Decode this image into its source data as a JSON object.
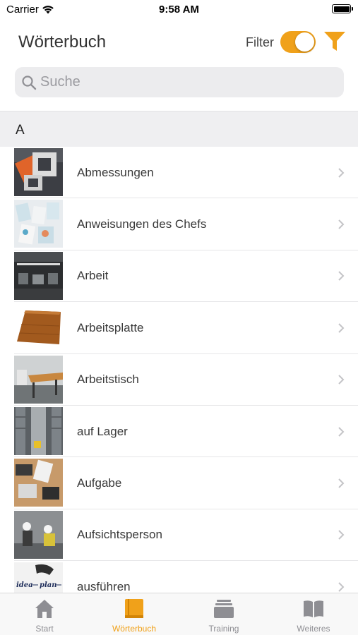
{
  "status_bar": {
    "carrier": "Carrier",
    "time": "9:58 AM"
  },
  "header": {
    "title": "Wörterbuch",
    "filter_label": "Filter",
    "filter_on": true
  },
  "search": {
    "placeholder": "Suche"
  },
  "section": {
    "letter": "A"
  },
  "entries": [
    {
      "label": "Abmessungen"
    },
    {
      "label": "Anweisungen des Chefs"
    },
    {
      "label": "Arbeit"
    },
    {
      "label": "Arbeitsplatte"
    },
    {
      "label": "Arbeitstisch"
    },
    {
      "label": "auf Lager"
    },
    {
      "label": "Aufgabe"
    },
    {
      "label": "Aufsichtsperson"
    },
    {
      "label": "ausführen",
      "thumb_text": [
        "idea",
        "plan"
      ]
    }
  ],
  "tabs": [
    {
      "label": "Start",
      "icon": "home-icon"
    },
    {
      "label": "Wörterbuch",
      "icon": "book-icon",
      "active": true
    },
    {
      "label": "Training",
      "icon": "cards-icon"
    },
    {
      "label": "Weiteres",
      "icon": "open-book-icon"
    }
  ],
  "colors": {
    "accent": "#f0a11a",
    "inactive": "#8e8e93",
    "section_bg": "#efeff1"
  }
}
